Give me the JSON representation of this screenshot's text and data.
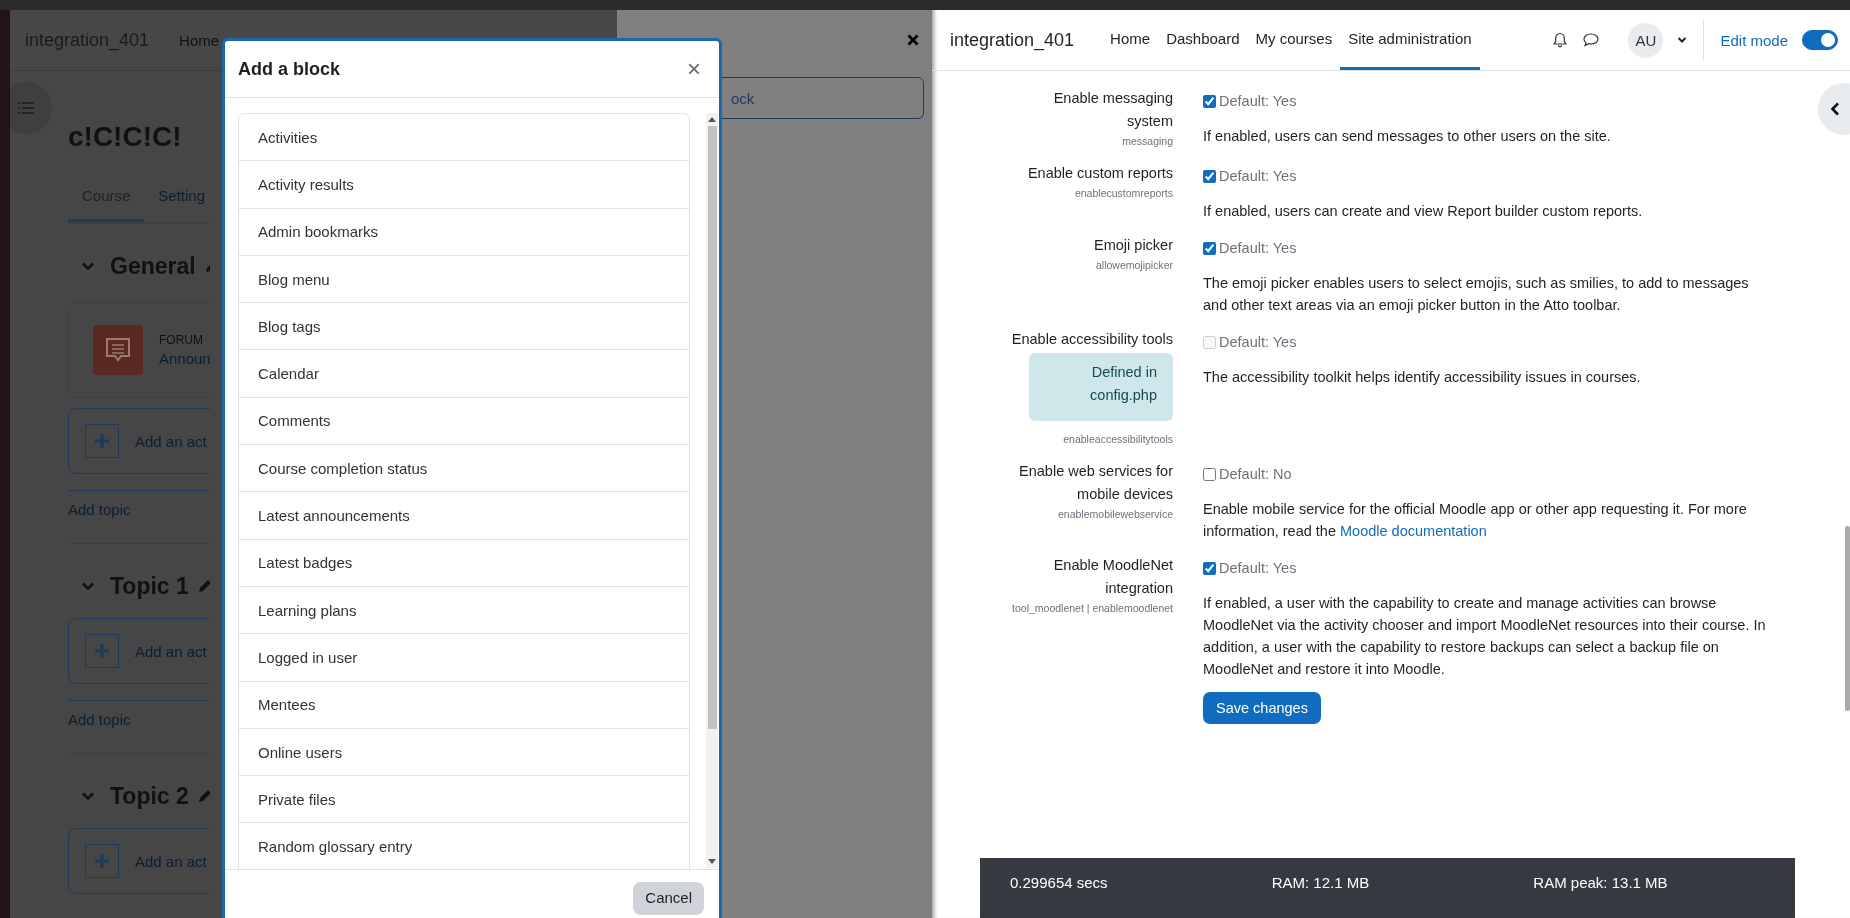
{
  "left_window": {
    "site_name": "integration_401",
    "nav": [
      {
        "label": "Home"
      }
    ],
    "course_title": "c!C!C!C!",
    "tabs": [
      {
        "label": "Course",
        "selected": true
      },
      {
        "label": "Setting",
        "selected": false
      }
    ],
    "sections": [
      {
        "title": "General",
        "expanded": true,
        "activities": [
          {
            "type_label": "FORUM",
            "name": "Announ"
          }
        ],
        "add_activity": "Add an act",
        "add_topic": "Add topic"
      },
      {
        "title": "Topic 1",
        "expanded": true,
        "add_activity": "Add an act",
        "add_topic": "Add topic"
      },
      {
        "title": "Topic 2",
        "expanded": true,
        "add_activity": "Add an act"
      }
    ],
    "drawer": {
      "button_text": "ock"
    }
  },
  "modal": {
    "title": "Add a block",
    "close": "×",
    "items": [
      {
        "label": "Activities"
      },
      {
        "label": "Activity results"
      },
      {
        "label": "Admin bookmarks"
      },
      {
        "label": "Blog menu"
      },
      {
        "label": "Blog tags"
      },
      {
        "label": "Calendar"
      },
      {
        "label": "Comments"
      },
      {
        "label": "Course completion status"
      },
      {
        "label": "Latest announcements"
      },
      {
        "label": "Latest badges"
      },
      {
        "label": "Learning plans"
      },
      {
        "label": "Logged in user"
      },
      {
        "label": "Mentees"
      },
      {
        "label": "Online users"
      },
      {
        "label": "Private files"
      },
      {
        "label": "Random glossary entry"
      }
    ],
    "cancel": "Cancel"
  },
  "right_window": {
    "site_name": "integration_401",
    "nav": [
      {
        "label": "Home",
        "selected": false
      },
      {
        "label": "Dashboard",
        "selected": false
      },
      {
        "label": "My courses",
        "selected": false
      },
      {
        "label": "Site administration",
        "selected": true
      }
    ],
    "avatar": "AU",
    "edit_mode": {
      "label": "Edit mode",
      "on": true
    },
    "settings": [
      {
        "label": "Enable messaging system",
        "key": "messaging",
        "checked": true,
        "disabled": false,
        "default": "Default: Yes",
        "description": "If enabled, users can send messages to other users on the site."
      },
      {
        "label": "Enable custom reports",
        "key": "enablecustomreports",
        "checked": true,
        "disabled": false,
        "default": "Default: Yes",
        "description": "If enabled, users can create and view Report builder custom reports."
      },
      {
        "label": "Emoji picker",
        "key": "allowemojipicker",
        "checked": true,
        "disabled": false,
        "default": "Default: Yes",
        "description": "The emoji picker enables users to select emojis, such as smilies, to add to messages and other text areas via an emoji picker button in the Atto toolbar."
      },
      {
        "label": "Enable accessibility tools",
        "locked_note": "Defined in config.php",
        "key": "enableaccessibilitytools",
        "checked": false,
        "disabled": true,
        "default": "Default: Yes",
        "description": "The accessibility toolkit helps identify accessibility issues in courses."
      },
      {
        "label": "Enable web services for mobile devices",
        "key": "enablemobilewebservice",
        "checked": false,
        "disabled": false,
        "default": "Default: No",
        "description": "Enable mobile service for the official Moodle app or other app requesting it. For more information, read the",
        "link": "Moodle documentation"
      },
      {
        "label": "Enable MoodleNet integration",
        "key": "tool_moodlenet | enablemoodlenet",
        "checked": true,
        "disabled": false,
        "default": "Default: Yes",
        "description": "If enabled, a user with the capability to create and manage activities can browse MoodleNet via the activity chooser and import MoodleNet resources into their course. In addition, a user with the capability to restore backups can select a backup file on MoodleNet and restore it into Moodle."
      }
    ],
    "save_button": "Save changes",
    "footer": [
      "0.299654 secs",
      "RAM: 12.1 MB",
      "RAM peak: 13.1 MB"
    ]
  }
}
